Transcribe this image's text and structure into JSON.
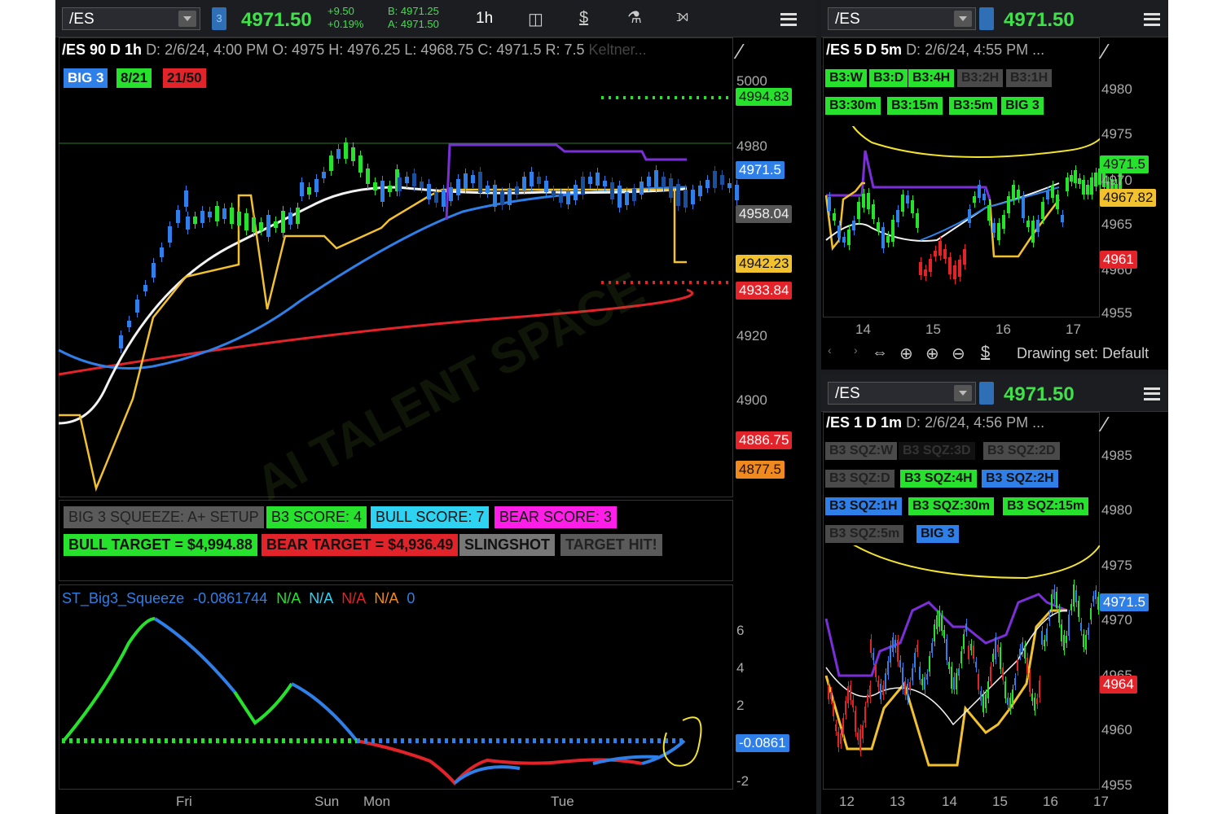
{
  "colors": {
    "green": "#27e22c",
    "blue": "#2f7fe8",
    "red": "#e2232a",
    "yellow": "#f2c12e",
    "purple": "#7a2fd8",
    "white": "#f2f2f2",
    "cyan": "#2fd3f2",
    "magenta": "#ff1ee8",
    "orange": "#f08a1e"
  },
  "toolbar": {
    "symbol": "/ES",
    "link": "3",
    "price": "4971.50",
    "change": "+9.50",
    "change_pct": "+0.19%",
    "bid": "B: 4971.25",
    "ask": "A: 4971.50",
    "timeframe": "1h"
  },
  "main_chart": {
    "title_symbol": "/ES 90 D 1h",
    "date": "D: 2/6/24, 4:00 PM",
    "open": "O: 4975",
    "high": "H: 4976.25",
    "low": "L: 4968.75",
    "close": "C: 4971.5",
    "range": "R: 7.5",
    "keltner": "Keltner...",
    "badges": [
      "BIG 3",
      "8/21",
      "21/50"
    ],
    "y_axis": [
      "5000",
      "4980",
      "4920",
      "4900"
    ],
    "price_tags": [
      {
        "text": "4994.83",
        "color": "green"
      },
      {
        "text": "4971.5",
        "color": "blue"
      },
      {
        "text": "4958.04",
        "color": "gray"
      },
      {
        "text": "4942.23",
        "color": "yellow"
      },
      {
        "text": "4933.84",
        "color": "red"
      },
      {
        "text": "4886.75",
        "color": "red"
      },
      {
        "text": "4877.5",
        "color": "orange"
      }
    ],
    "x_axis": [
      "Fri",
      "Sun",
      "Mon",
      "Tue"
    ]
  },
  "squeeze_labels": {
    "row1": [
      "BIG 3 SQUEEZE: A+ SETUP",
      "B3 SCORE:  4",
      "BULL SCORE:  7",
      "BEAR SCORE:  3"
    ],
    "row2": [
      "BULL TARGET = $4,994.88",
      "BEAR TARGET = $4,936.49",
      "SLINGSHOT",
      "TARGET HIT!"
    ]
  },
  "indicator": {
    "name": "ST_Big3_Squeeze",
    "value": "-0.0861744",
    "values": [
      "N/A",
      "N/A",
      "N/A",
      "N/A",
      "0"
    ],
    "y_axis": [
      "6",
      "4",
      "2",
      "-2"
    ],
    "tag": "-0.0861"
  },
  "chart_5m": {
    "symbol": "/ES",
    "price": "4971.50",
    "title_symbol": "/ES 5 D 5m",
    "date": "D: 2/6/24, 4:55 PM ...",
    "badges_row1": [
      "B3:W",
      "B3:D",
      "B3:4H",
      "B3:2H",
      "B3:1H"
    ],
    "badges_row2": [
      "B3:30m",
      "B3:15m",
      "B3:5m",
      "BIG 3"
    ],
    "y_axis": [
      "4980",
      "4975",
      "4970",
      "4965",
      "4960",
      "4955"
    ],
    "price_tags": [
      {
        "text": "4971.5",
        "color": "green"
      },
      {
        "text": "4967.82",
        "color": "yellow"
      },
      {
        "text": "4961",
        "color": "red"
      }
    ],
    "x_axis": [
      "14",
      "15",
      "16",
      "17"
    ],
    "drawing_set": "Drawing set: Default"
  },
  "chart_1m": {
    "symbol": "/ES",
    "price": "4971.50",
    "title_symbol": "/ES 1 D 1m",
    "date": "D: 2/6/24, 4:56 PM ...",
    "badges_row1": [
      "B3 SQZ:W",
      "B3 SQZ:3D",
      "B3 SQZ:2D"
    ],
    "badges_row2": [
      "B3 SQZ:D",
      "B3 SQZ:4H",
      "B3 SQZ:2H"
    ],
    "badges_row3": [
      "B3 SQZ:1H",
      "B3 SQZ:30m",
      "B3 SQZ:15m"
    ],
    "badges_row4": [
      "B3 SQZ:5m",
      "BIG 3"
    ],
    "y_axis": [
      "4985",
      "4980",
      "4975",
      "4970",
      "4965",
      "4960",
      "4955"
    ],
    "price_tags": [
      {
        "text": "4971.5",
        "color": "blue"
      },
      {
        "text": "4964",
        "color": "red"
      }
    ],
    "x_axis": [
      "12",
      "13",
      "14",
      "15",
      "16",
      "17"
    ]
  },
  "watermark": "AI TALENT SPACE"
}
